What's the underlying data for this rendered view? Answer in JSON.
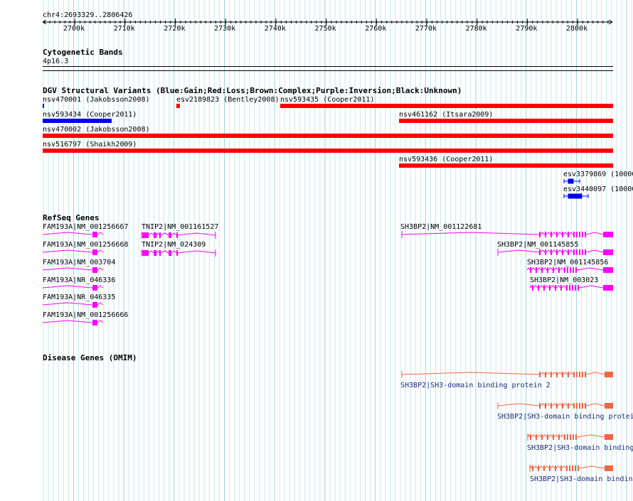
{
  "region": "chr4:2693329..2806426",
  "ruler_ticks": [
    "2700k",
    "2710k",
    "2720k",
    "2730k",
    "2740k",
    "2750k",
    "2760k",
    "2770k",
    "2780k",
    "2790k",
    "2800k"
  ],
  "tracks": {
    "cytoband": {
      "title": "Cytogenetic Bands",
      "band": "4p16.3"
    },
    "dgv": {
      "title": "DGV Structural Variants (Blue:Gain;Red:Loss;Brown:Complex;Purple:Inversion;Black:Unknown)",
      "colors": {
        "gain": "#0000ee",
        "loss": "#ff0000"
      },
      "variants": [
        {
          "label": "nsv470001 (Jakobsson2008)",
          "type": "gain"
        },
        {
          "label": "esv2189823 (Bentley2008)",
          "type": "loss"
        },
        {
          "label": "nsv593435 (Cooper2011)",
          "type": "loss"
        },
        {
          "label": "nsv593434 (Cooper2011)",
          "type": "gain"
        },
        {
          "label": "nsv461162 (Itsara2009)",
          "type": "loss"
        },
        {
          "label": "nsv470002 (Jakobsson2008)",
          "type": "loss"
        },
        {
          "label": "nsv516797 (Shaikh2009)",
          "type": "loss"
        },
        {
          "label": "nsv593436 (Cooper2011)",
          "type": "loss"
        },
        {
          "label": "esv3379869 (10000",
          "type": "gain"
        },
        {
          "label": "esv3440097 (10000",
          "type": "gain"
        }
      ]
    },
    "refseq": {
      "title": "RefSeq Genes",
      "color": "#ff00ff",
      "genes": [
        "FAM193A|NM_001256667",
        "FAM193A|NM_001256668",
        "FAM193A|NM_003704",
        "FAM193A|NR_046336",
        "FAM193A|NR_046335",
        "FAM193A|NM_001256666",
        "TNIP2|NM_001161527",
        "TNIP2|NM_024309",
        "SH3BP2|NM_001122681",
        "SH3BP2|NM_001145855",
        "SH3BP2|NM_001145856",
        "SH3BP2|NM_003023"
      ]
    },
    "omim": {
      "title": "Disease Genes (OMIM)",
      "color": "#ee6644",
      "genes": [
        "SH3BP2|SH3-domain binding protein 2",
        "SH3BP2|SH3-domain binding protei",
        "SH3BP2|SH3-domain binding",
        "SH3BP2|SH3-domain bindin"
      ]
    }
  }
}
